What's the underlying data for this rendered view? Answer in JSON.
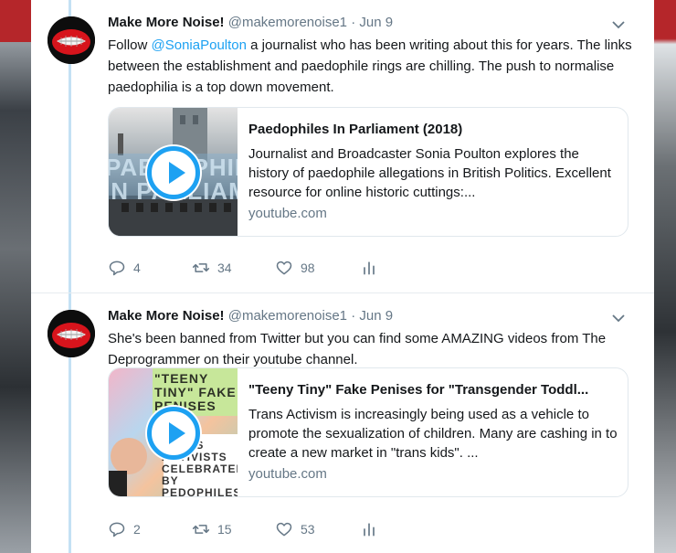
{
  "tweets": [
    {
      "name": "Make More Noise!",
      "handle": "@makemorenoise1",
      "separator": "·",
      "date": "Jun 9",
      "text_pre": "Follow ",
      "mention": "@SoniaPoulton",
      "text_post": " a journalist who has been writing about this for years. The links between the establishment and paedophile rings are chilling. The push to normalise paedophilia is a top down movement.",
      "card": {
        "thumb_text_1": "PAEDOPHILES",
        "thumb_text_2": "IN PARLIAMENT",
        "title": "Paedophiles In Parliament (2018)",
        "description": "Journalist and Broadcaster Sonia Poulton explores the history of paedophile allegations in British Politics. Excellent resource for online historic cuttings:...",
        "domain": "youtube.com"
      },
      "replies": "4",
      "retweets": "34",
      "likes": "98"
    },
    {
      "name": "Make More Noise!",
      "handle": "@makemorenoise1",
      "separator": "·",
      "date": "Jun 9",
      "text_pre": "She's been banned from Twitter but you can find some AMAZING videos from The Deprogrammer on their youtube channel.",
      "mention": "",
      "text_post": "",
      "card": {
        "thumb_text_1": "\"TEENY TINY\" FAKE PENISES",
        "thumb_text_2": "TRANS ACTIVISTS CELEBRATED BY PEDOPHILES ON SOCIAL MEDIA.",
        "title": "\"Teeny Tiny\" Fake Penises for \"Transgender Toddl...",
        "description": "Trans Activism is increasingly being used as a vehicle to promote the sexualization of children. Many are cashing in to create a new market in \"trans kids\". ...",
        "domain": "youtube.com"
      },
      "replies": "2",
      "retweets": "15",
      "likes": "53"
    }
  ],
  "icons": {
    "reply": "reply-icon",
    "retweet": "retweet-icon",
    "like": "heart-icon",
    "analytics": "analytics-icon",
    "caret": "chevron-down-icon",
    "play": "play-icon"
  },
  "colors": {
    "link": "#1da1f2",
    "muted": "#657786",
    "thread_line": "#c4e1f4"
  }
}
